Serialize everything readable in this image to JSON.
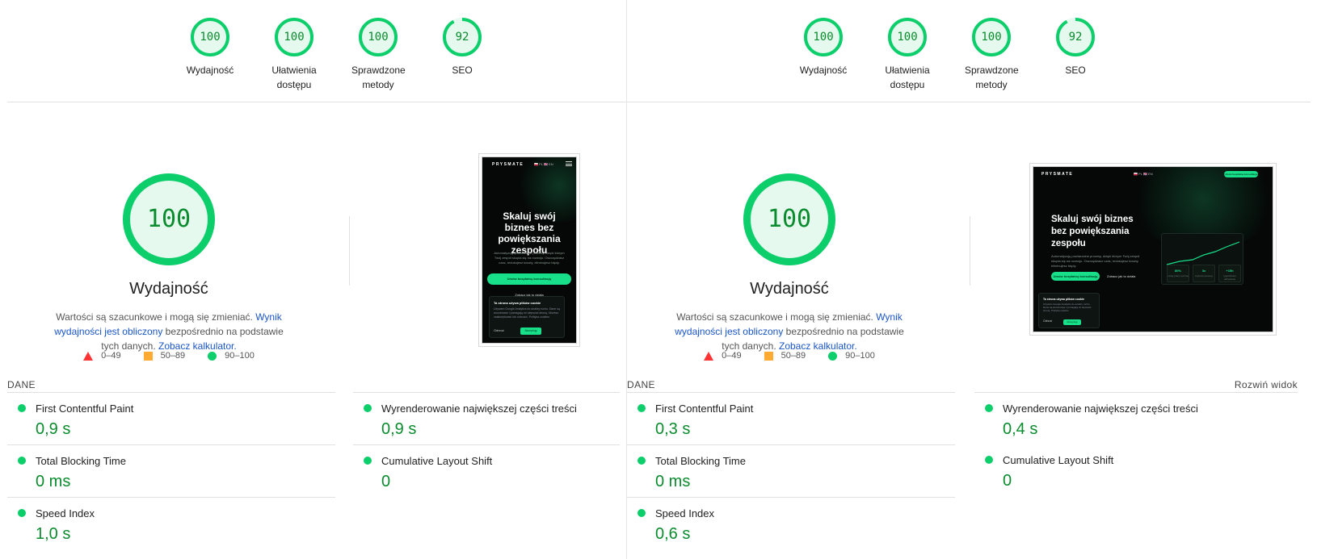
{
  "colors": {
    "pass": "#0cce6b",
    "pass_text": "#0a8c2e",
    "pass_bg": "#e5f9ee",
    "average": "#ffaa33",
    "fail": "#ff3333",
    "link": "#1a55c9"
  },
  "panels": [
    {
      "gauges": [
        {
          "score": "100",
          "value": 100,
          "label": "Wydajność"
        },
        {
          "score": "100",
          "value": 100,
          "label": "Ułatwienia dostępu"
        },
        {
          "score": "100",
          "value": 100,
          "label": "Sprawdzone metody"
        },
        {
          "score": "92",
          "value": 92,
          "label": "SEO"
        }
      ],
      "performance": {
        "score": "100",
        "value": 100,
        "title": "Wydajność",
        "desc_prefix": "Wartości są szacunkowe i mogą się zmieniać. ",
        "desc_link1": "Wynik wydajności jest obliczony",
        "desc_middle": " bezpośrednio na podstawie tych danych. ",
        "desc_link2": "Zobacz kalkulator."
      },
      "legend": {
        "fail": "0–49",
        "average": "50–89",
        "pass": "90–100"
      },
      "section_label": "DANE",
      "expand_label": "",
      "screenshot": {
        "brand": "PRYSMATE",
        "flags": "🇵🇱 PL  🇬🇧 EN",
        "headline": "Skaluj swój biznes bez powiększania zespołu",
        "sub": "Automatyzuję powtarzalne procesy, dzięki którym Twój zespół skupia się na rozwoju. Oszczędzasz czas, redukujesz koszty, eliminujesz błędy.",
        "cta": "Umów bezpłatną konsultację",
        "secondary": "Zobacz jak to działa",
        "cookie_title": "Ta strona używa plików cookie",
        "cookie_desc": "Używam Google Analytics do analizy ruchu. Dane są anonimowe i pomagają mi ulepszać stronę. Możesz zaakceptować lub odrzucić. Polityka cookies",
        "cookie_reject": "Odrzuć",
        "cookie_accept": "Akceptuję"
      },
      "metrics": [
        {
          "name": "First Contentful Paint",
          "value": "0,9 s"
        },
        {
          "name": "Wyrenderowanie największej części treści",
          "value": "0,9 s"
        },
        {
          "name": "Total Blocking Time",
          "value": "0 ms"
        },
        {
          "name": "Cumulative Layout Shift",
          "value": "0"
        },
        {
          "name": "Speed Index",
          "value": "1,0 s"
        }
      ]
    },
    {
      "gauges": [
        {
          "score": "100",
          "value": 100,
          "label": "Wydajność"
        },
        {
          "score": "100",
          "value": 100,
          "label": "Ułatwienia dostępu"
        },
        {
          "score": "100",
          "value": 100,
          "label": "Sprawdzone metody"
        },
        {
          "score": "92",
          "value": 92,
          "label": "SEO"
        }
      ],
      "performance": {
        "score": "100",
        "value": 100,
        "title": "Wydajność",
        "desc_prefix": "Wartości są szacunkowe i mogą się zmieniać. ",
        "desc_link1": "Wynik wydajności jest obliczony",
        "desc_middle": " bezpośrednio na podstawie tych danych. ",
        "desc_link2": "Zobacz kalkulator."
      },
      "legend": {
        "fail": "0–49",
        "average": "50–89",
        "pass": "90–100"
      },
      "section_label": "DANE",
      "expand_label": "Rozwiń widok",
      "screenshot": {
        "brand": "PRYSMATE",
        "flags": "🇵🇱 PL  🇬🇧 EN",
        "headline": "Skaluj swój biznes bez powiększania zespołu",
        "sub": "Automatyzuję powtarzalne procesy, dzięki którym Twój zespół skupia się na rozwoju. Oszczędzasz czas, redukujesz koszty, eliminujesz błędy.",
        "cta": "Umów bezpłatną konsultację",
        "secondary": "Zobacz jak to działa",
        "cookie_title": "Ta strona używa plików cookie",
        "cookie_desc": "Używam Google Analytics do analizy ruchu. Dane są anonimowe i pomagają mi ulepszać stronę. Polityka cookies",
        "cookie_reject": "Odrzuć",
        "cookie_accept": "Akceptuję",
        "card_stats": [
          {
            "value": "80%",
            "label": "mniej pracy ręcznej"
          },
          {
            "value": "3x",
            "label": "szybsze procesy"
          },
          {
            "value": "+15h",
            "label": "tygodniowo odzyskane"
          }
        ]
      },
      "metrics": [
        {
          "name": "First Contentful Paint",
          "value": "0,3 s"
        },
        {
          "name": "Wyrenderowanie największej części treści",
          "value": "0,4 s"
        },
        {
          "name": "Total Blocking Time",
          "value": "0 ms"
        },
        {
          "name": "Cumulative Layout Shift",
          "value": "0"
        },
        {
          "name": "Speed Index",
          "value": "0,6 s"
        }
      ]
    }
  ]
}
